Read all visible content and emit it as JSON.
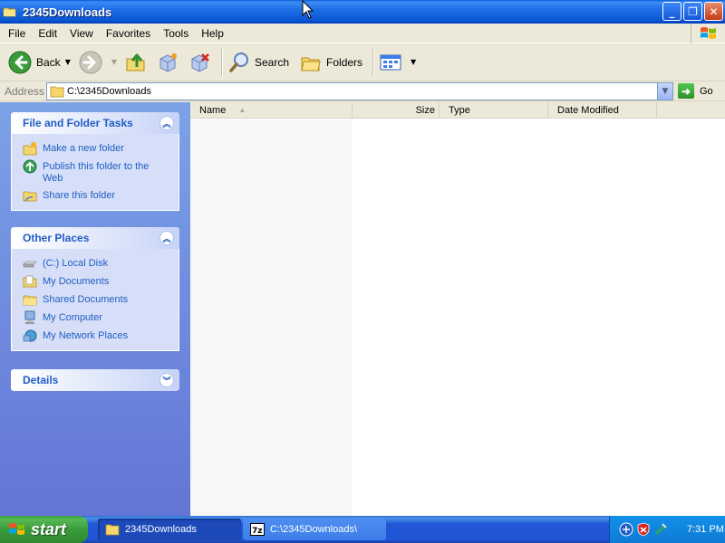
{
  "window": {
    "title": "2345Downloads",
    "buttons": {
      "minimize": "_",
      "maximize": "❐",
      "close": "✕"
    }
  },
  "menu": [
    "File",
    "Edit",
    "View",
    "Favorites",
    "Tools",
    "Help"
  ],
  "toolbar": {
    "back_label": "Back",
    "search_label": "Search",
    "folders_label": "Folders"
  },
  "address": {
    "label": "Address",
    "value": "C:\\2345Downloads",
    "go_label": "Go"
  },
  "panels": {
    "file_tasks": {
      "title": "File and Folder Tasks",
      "items": [
        {
          "label": "Make a new folder",
          "icon": "new-folder-icon"
        },
        {
          "label": "Publish this folder to the Web",
          "icon": "publish-web-icon"
        },
        {
          "label": "Share this folder",
          "icon": "share-folder-icon"
        }
      ]
    },
    "other_places": {
      "title": "Other Places",
      "items": [
        {
          "label": "(C:) Local Disk",
          "icon": "local-disk-icon"
        },
        {
          "label": "My Documents",
          "icon": "my-documents-icon"
        },
        {
          "label": "Shared Documents",
          "icon": "shared-documents-icon"
        },
        {
          "label": "My Computer",
          "icon": "my-computer-icon"
        },
        {
          "label": "My Network Places",
          "icon": "network-places-icon"
        }
      ]
    },
    "details": {
      "title": "Details"
    }
  },
  "columns": [
    "Name",
    "Size",
    "Type",
    "Date Modified"
  ],
  "taskbar": {
    "start_label": "start",
    "tasks": [
      {
        "label": "2345Downloads",
        "icon": "folder-icon",
        "active": true
      },
      {
        "label": "C:\\2345Downloads\\",
        "icon": "7zip-icon",
        "active": false
      }
    ],
    "clock": "7:31 PM"
  },
  "colors": {
    "titlebar": "#0a55d2",
    "taskpane": "#7ba2e7",
    "link": "#215dc6",
    "start": "#3c9a3c"
  }
}
